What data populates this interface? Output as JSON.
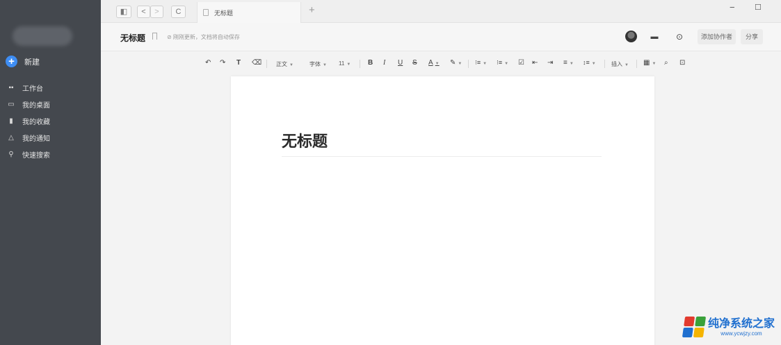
{
  "sidebar": {
    "new_label": "新建",
    "items": [
      {
        "label": "工作台",
        "icon": "workbench-icon"
      },
      {
        "label": "我的桌面",
        "icon": "desktop-icon"
      },
      {
        "label": "我的收藏",
        "icon": "bookmark-icon"
      },
      {
        "label": "我的通知",
        "icon": "bell-icon"
      },
      {
        "label": "快速搜索",
        "icon": "search-icon"
      }
    ]
  },
  "tabbar": {
    "tab_title": "无标题",
    "new_tab": "+",
    "back": "<",
    "forward": ">",
    "refresh": "C",
    "sidebar_toggle": "◧",
    "minimize": "−",
    "maximize": "☐"
  },
  "header": {
    "title": "无标题",
    "status": "⊘ 刚刚更新，文档将自动保存",
    "add_collaborator": "添加协作者",
    "share": "分享"
  },
  "toolbar": {
    "undo": "↶",
    "redo": "↷",
    "format_painter": "T",
    "clear_format": "⌫",
    "paragraph_style": "正文",
    "font": "字体",
    "font_size": "11",
    "bold": "B",
    "italic": "I",
    "underline": "U",
    "strikethrough": "S",
    "font_color": "A",
    "highlight": "✎",
    "ordered_list": "⁝≡",
    "unordered_list": "⁝≡",
    "checklist": "☑",
    "indent_decrease": "⇤",
    "indent_increase": "⇥",
    "align": "≡",
    "line_spacing": "↕≡",
    "insert": "插入",
    "table": "▦",
    "find": "⌕",
    "comment": "⊡"
  },
  "document": {
    "title": "无标题"
  },
  "watermark": {
    "text": "纯净系统之家",
    "url": "www.ycwjzy.com",
    "colors": [
      "#e23b2e",
      "#3aa13a",
      "#1f6fcf",
      "#f5b400"
    ]
  }
}
